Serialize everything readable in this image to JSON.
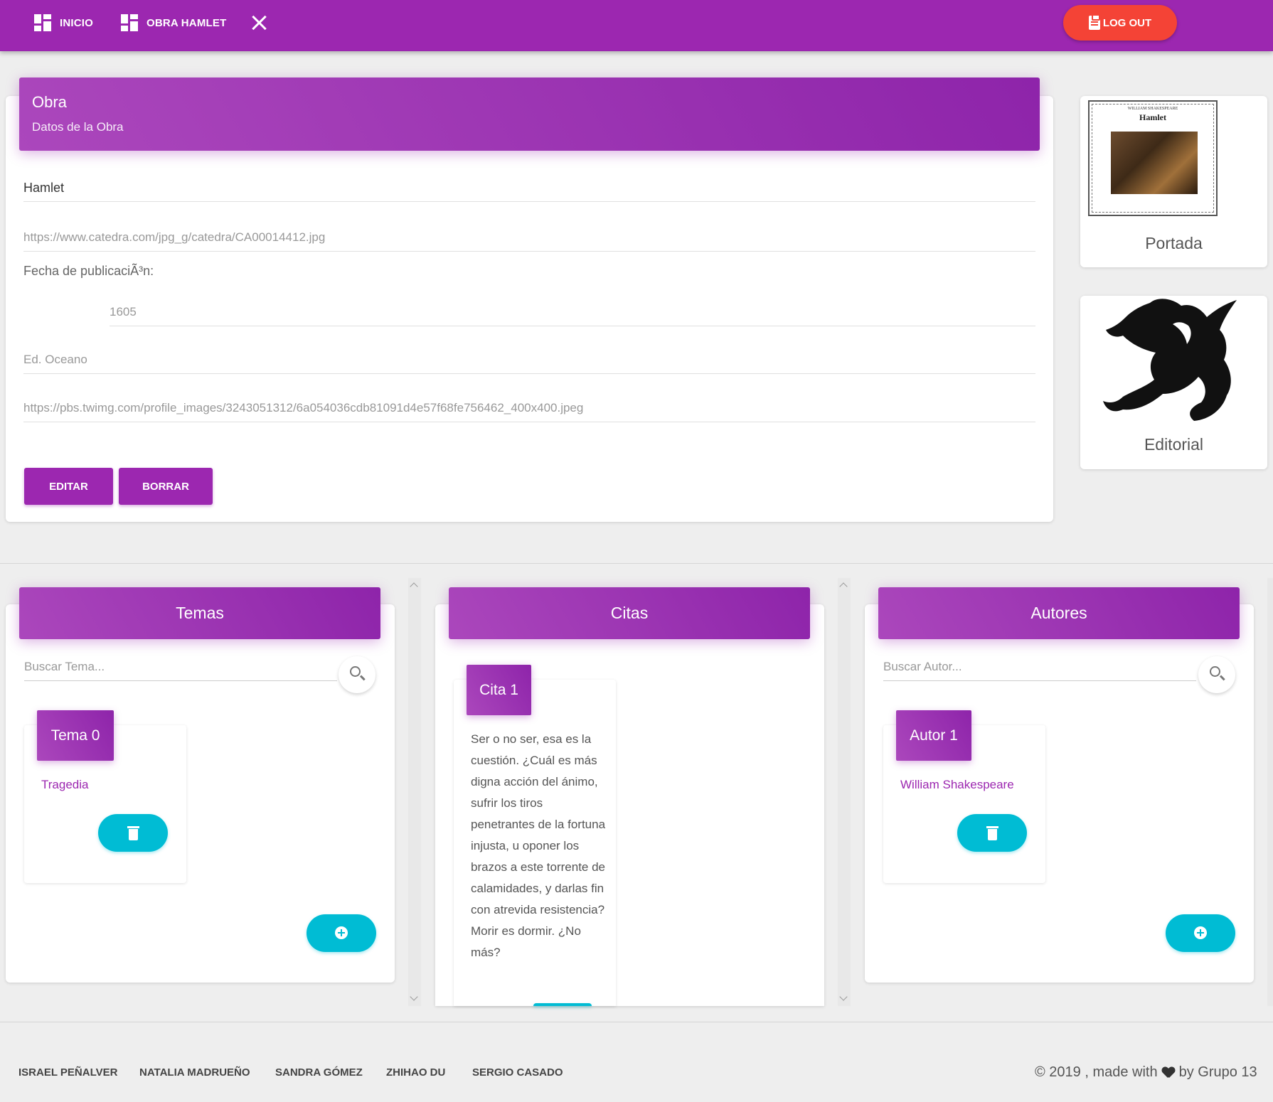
{
  "nav": {
    "inicio_label": "INICIO",
    "obra_label": "OBRA HAMLET",
    "logout_label": "LOG OUT"
  },
  "obra": {
    "title": "Obra",
    "subtitle": "Datos de la Obra",
    "nombre": "Hamlet",
    "portada_url": "https://www.catedra.com/jpg_g/catedra/CA00014412.jpg",
    "fecha_label": "Fecha de publicaciÃ³n:",
    "fecha_value": "1605",
    "editorial": "Ed. Oceano",
    "editorial_url": "https://pbs.twimg.com/profile_images/3243051312/6a054036cdb81091d4e57f68fe756462_400x400.jpeg",
    "edit_label": "EDITAR",
    "delete_label": "BORRAR"
  },
  "side": {
    "portada_label": "Portada",
    "editorial_label": "Editorial",
    "book_header": "WILLIAM SHAKESPEARE",
    "book_title": "Hamlet"
  },
  "temas": {
    "title": "Temas",
    "search_placeholder": "Buscar Tema...",
    "card_title": "Tema 0",
    "card_value": "Tragedia"
  },
  "citas": {
    "title": "Citas",
    "card_title": "Cita 1",
    "quote": "Ser o no ser, esa es la cuestión. ¿Cuál es más digna acción del ánimo, sufrir los tiros penetrantes de la fortuna injusta, u oponer los brazos a este torrente de calamidades, y darlas fin con atrevida resistencia? Morir es dormir. ¿No más?"
  },
  "autores": {
    "title": "Autores",
    "search_placeholder": "Buscar Autor...",
    "card_title": "Autor 1",
    "card_value": "William Shakespeare"
  },
  "footer": {
    "links": [
      "ISRAEL PEÑALVER",
      "NATALIA MADRUEÑO",
      "SANDRA GÓMEZ",
      "ZHIHAO DU",
      "SERGIO CASADO"
    ],
    "copyright_prefix": "© 2019 , made with",
    "copyright_suffix": "by Grupo 13"
  },
  "colors": {
    "primary": "#9c27b0",
    "logout": "#f44336",
    "accent": "#00bcd4"
  }
}
